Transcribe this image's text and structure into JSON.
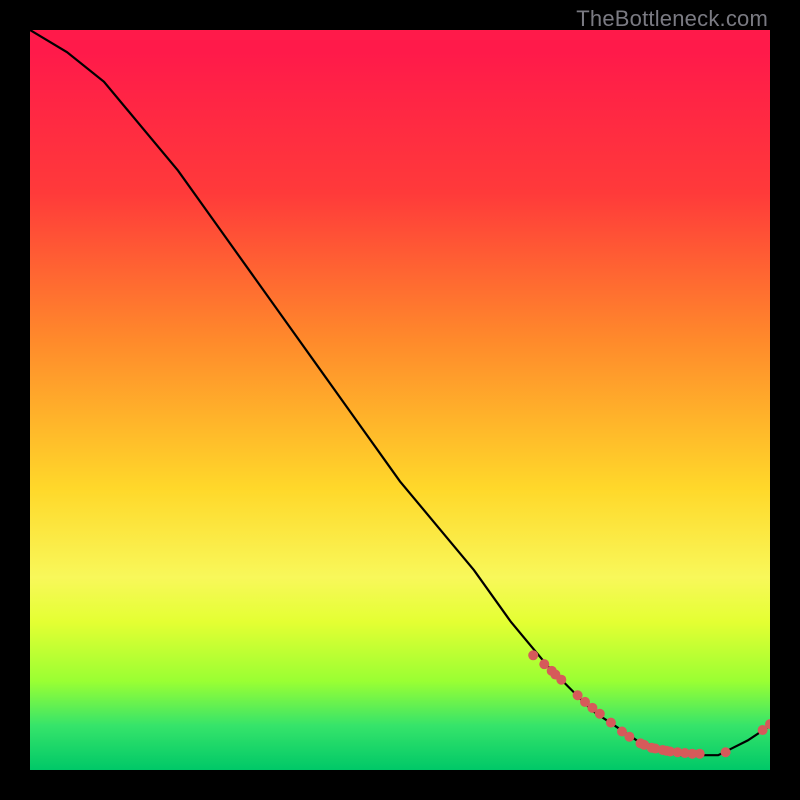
{
  "watermark": {
    "text": "TheBottleneck.com"
  },
  "chart_data": {
    "type": "line",
    "title": "",
    "xlabel": "",
    "ylabel": "",
    "xlim": [
      0,
      100
    ],
    "ylim": [
      0,
      100
    ],
    "legend": false,
    "grid": false,
    "background_gradient": {
      "direction": "vertical",
      "stops": [
        {
          "pos": 0.0,
          "color": "#ff1a4a"
        },
        {
          "pos": 0.22,
          "color": "#ff3a3a"
        },
        {
          "pos": 0.42,
          "color": "#ff8a2b"
        },
        {
          "pos": 0.62,
          "color": "#ffd82a"
        },
        {
          "pos": 0.8,
          "color": "#e4ff33"
        },
        {
          "pos": 0.94,
          "color": "#36e46a"
        },
        {
          "pos": 1.0,
          "color": "#00c868"
        }
      ]
    },
    "series": [
      {
        "name": "bottleneck-curve",
        "color": "#000000",
        "x": [
          0,
          5,
          10,
          15,
          20,
          25,
          30,
          35,
          40,
          45,
          50,
          55,
          60,
          65,
          70,
          73,
          76,
          79,
          82,
          85,
          88,
          91,
          93,
          95,
          97,
          100
        ],
        "y": [
          100,
          97,
          93,
          87,
          81,
          74,
          67,
          60,
          53,
          46,
          39,
          33,
          27,
          20,
          14,
          11,
          8,
          6,
          4,
          3,
          2,
          2,
          2,
          3,
          4,
          6
        ]
      }
    ],
    "markers": {
      "name": "data-points",
      "color": "#d65a5a",
      "radius_px": 5,
      "x": [
        68,
        69.5,
        70.5,
        71,
        71.8,
        74,
        75,
        76,
        77,
        78.5,
        80,
        81,
        82.5,
        83,
        84,
        84.5,
        85.5,
        86,
        86.5,
        87.5,
        88.5,
        89.5,
        90.5,
        94,
        99,
        100
      ],
      "y": [
        15.5,
        14.3,
        13.4,
        12.9,
        12.2,
        10.1,
        9.2,
        8.4,
        7.6,
        6.4,
        5.2,
        4.5,
        3.6,
        3.4,
        3.0,
        2.9,
        2.7,
        2.6,
        2.5,
        2.4,
        2.3,
        2.2,
        2.2,
        2.4,
        5.4,
        6.2
      ]
    }
  }
}
